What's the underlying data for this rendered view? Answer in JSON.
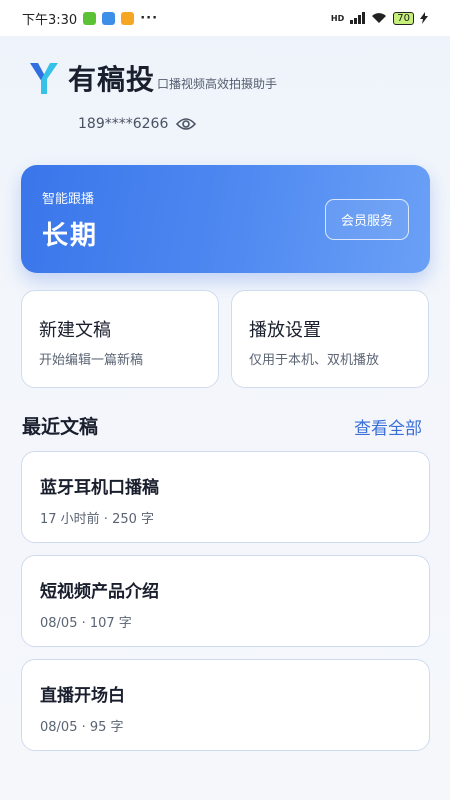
{
  "status_bar": {
    "time": "下午3:30",
    "more": "···",
    "network": "HD",
    "battery": "70"
  },
  "app": {
    "title": "有稿投",
    "subtitle": "口播视频高效拍摄助手",
    "phone": "189****6266"
  },
  "vip_card": {
    "label": "智能跟播",
    "value": "长期",
    "button_label": "会员服务"
  },
  "actions": [
    {
      "title": "新建文稿",
      "desc": "开始编辑一篇新稿"
    },
    {
      "title": "播放设置",
      "desc": "仅用于本机、双机播放"
    }
  ],
  "recent": {
    "title": "最近文稿",
    "view_all": "查看全部",
    "items": [
      {
        "title": "蓝牙耳机口播稿",
        "meta": "17 小时前 · 250 字"
      },
      {
        "title": "短视频产品介绍",
        "meta": "08/05 · 107 字"
      },
      {
        "title": "直播开场白",
        "meta": "08/05 · 95 字"
      }
    ]
  },
  "colors": {
    "accent": "#3a6fd8",
    "card_gradient_start": "#3a76ea",
    "card_gradient_end": "#6aa0f6",
    "logo_blue": "#2f6fe0",
    "logo_cyan": "#36c2e8"
  },
  "icons": {
    "notif_1": "wechat-icon",
    "notif_2": "mail-icon",
    "notif_3": "gallery-icon",
    "visibility": "eye-icon"
  }
}
